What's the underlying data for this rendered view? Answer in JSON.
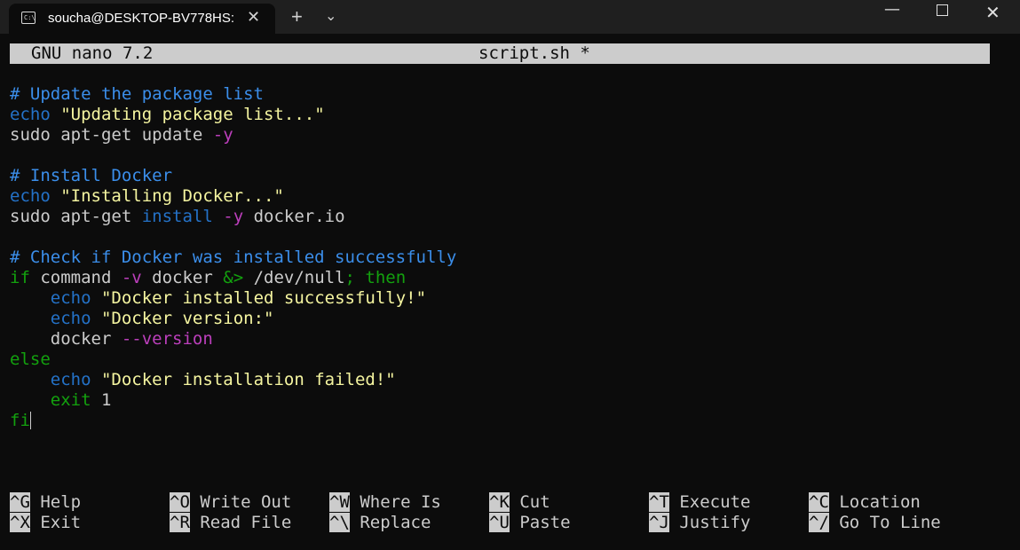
{
  "window": {
    "tab_title": "soucha@DESKTOP-BV778HS:",
    "tab_close": "✕",
    "new_tab": "+",
    "dropdown": "⌄",
    "minimize": "—",
    "close": "✕",
    "icons": {
      "tab": "terminal-icon",
      "new_tab": "plus-icon",
      "dropdown": "chevron-down-icon"
    }
  },
  "nano": {
    "version": "GNU nano 7.2",
    "filename": "script.sh *"
  },
  "code": [
    [
      {
        "t": "# Update the package list",
        "c": "cm"
      }
    ],
    [
      {
        "t": "echo",
        "c": "kw"
      },
      {
        "t": " "
      },
      {
        "t": "\"Updating package list...\"",
        "c": "st"
      }
    ],
    [
      {
        "t": "sudo apt-get update "
      },
      {
        "t": "-y",
        "c": "fl"
      }
    ],
    [],
    [
      {
        "t": "# Install Docker",
        "c": "cm"
      }
    ],
    [
      {
        "t": "echo",
        "c": "kw"
      },
      {
        "t": " "
      },
      {
        "t": "\"Installing Docker...\"",
        "c": "st"
      }
    ],
    [
      {
        "t": "sudo apt-get "
      },
      {
        "t": "install",
        "c": "kw"
      },
      {
        "t": " "
      },
      {
        "t": "-y",
        "c": "fl"
      },
      {
        "t": " docker.io"
      }
    ],
    [],
    [
      {
        "t": "# Check if Docker was installed successfully",
        "c": "cm"
      }
    ],
    [
      {
        "t": "if",
        "c": "ct"
      },
      {
        "t": " command "
      },
      {
        "t": "-v",
        "c": "fl"
      },
      {
        "t": " docker "
      },
      {
        "t": "&>",
        "c": "ct"
      },
      {
        "t": " /dev/null"
      },
      {
        "t": "; then",
        "c": "ct"
      }
    ],
    [
      {
        "t": "    "
      },
      {
        "t": "echo",
        "c": "kw"
      },
      {
        "t": " "
      },
      {
        "t": "\"Docker installed successfully!\"",
        "c": "st"
      }
    ],
    [
      {
        "t": "    "
      },
      {
        "t": "echo",
        "c": "kw"
      },
      {
        "t": " "
      },
      {
        "t": "\"Docker version:\"",
        "c": "st"
      }
    ],
    [
      {
        "t": "    docker "
      },
      {
        "t": "--version",
        "c": "fl"
      }
    ],
    [
      {
        "t": "else",
        "c": "ct"
      }
    ],
    [
      {
        "t": "    "
      },
      {
        "t": "echo",
        "c": "kw"
      },
      {
        "t": " "
      },
      {
        "t": "\"Docker installation failed!\"",
        "c": "st"
      }
    ],
    [
      {
        "t": "    "
      },
      {
        "t": "exit",
        "c": "ct"
      },
      {
        "t": " 1"
      }
    ],
    [
      {
        "t": "fi",
        "c": "ct"
      },
      {
        "cursor": true
      }
    ]
  ],
  "shortcuts": [
    [
      {
        "key": "^G",
        "label": "Help",
        "name": "help"
      },
      {
        "key": "^O",
        "label": "Write Out",
        "name": "write-out"
      },
      {
        "key": "^W",
        "label": "Where Is",
        "name": "where-is"
      },
      {
        "key": "^K",
        "label": "Cut",
        "name": "cut"
      },
      {
        "key": "^T",
        "label": "Execute",
        "name": "execute"
      },
      {
        "key": "^C",
        "label": "Location",
        "name": "location"
      }
    ],
    [
      {
        "key": "^X",
        "label": "Exit",
        "name": "exit"
      },
      {
        "key": "^R",
        "label": "Read File",
        "name": "read-file"
      },
      {
        "key": "^\\",
        "label": "Replace",
        "name": "replace"
      },
      {
        "key": "^U",
        "label": "Paste",
        "name": "paste"
      },
      {
        "key": "^J",
        "label": "Justify",
        "name": "justify"
      },
      {
        "key": "^/",
        "label": "Go To Line",
        "name": "go-to-line"
      }
    ]
  ]
}
